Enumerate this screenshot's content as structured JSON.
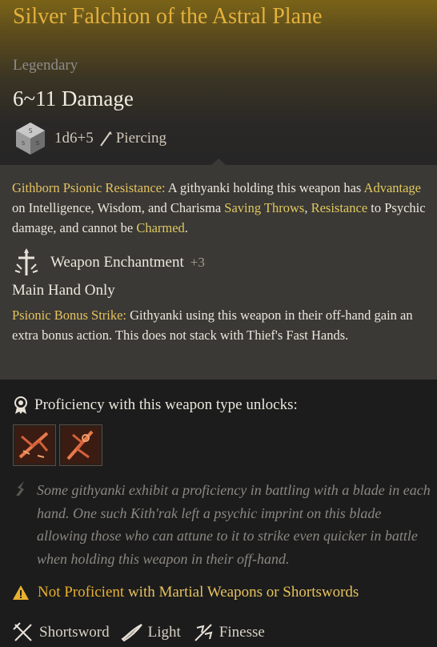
{
  "item": {
    "name": "Silver Falchion of the Astral Plane",
    "rarity": "Legendary",
    "damage": "6~11 Damage",
    "roll": "1d6+5",
    "damage_type": "Piercing"
  },
  "passive": {
    "name": "Githborn Psionic Resistance:",
    "t1": " A githyanki holding this weapon has ",
    "k1": "Advantage",
    "t2": " on Intelligence, Wisdom, and Charisma ",
    "k2": "Saving Throws",
    "t3": ", ",
    "k3": "Resistance",
    "t4": " to Psychic damage, and cannot be ",
    "k4": "Charmed",
    "t5": "."
  },
  "enchantment": {
    "label": "Weapon Enchantment",
    "bonus": "+3"
  },
  "main_hand_only": "Main Hand Only",
  "bonus_strike": {
    "name": "Psionic Bonus Strike:",
    "text": " Githyanki using this weapon in their off-hand gain an extra bonus action. This does not stack with Thief's Fast Hands."
  },
  "proficiency": {
    "label": "Proficiency with this weapon type unlocks:"
  },
  "lore": "Some githyanki exhibit a proficiency in battling with a blade in each hand. One such Kith'rak left a psychic imprint on this blade allowing those who can attune to it to strike even quicker in battle when holding this weapon in their off-hand.",
  "warning": {
    "a": "Not",
    "b": " Proficient",
    "c": " with Martial Weapons or Shortswords"
  },
  "tags": {
    "type": "Shortsword",
    "light": "Light",
    "finesse": "Finesse"
  },
  "colors": {
    "title_gold": "#e4b13b",
    "keyword_gold": "#e6c25e",
    "warning_orange": "#e8b030",
    "panel_bg": "#3a3936",
    "lower_bg": "#1c1c1c"
  },
  "icons": {
    "dice": "d6-die-icon",
    "damage_type": "piercing-icon",
    "enchantment": "sword-enchant-icon",
    "proficiency": "proficiency-badge-icon",
    "unlock1": "weapon-action-icon",
    "unlock2": "weapon-action-icon",
    "lore": "quill-icon",
    "warning": "warning-icon",
    "tag_type": "crossed-swords-icon",
    "tag_light": "feather-icon",
    "tag_finesse": "finesse-icon"
  }
}
